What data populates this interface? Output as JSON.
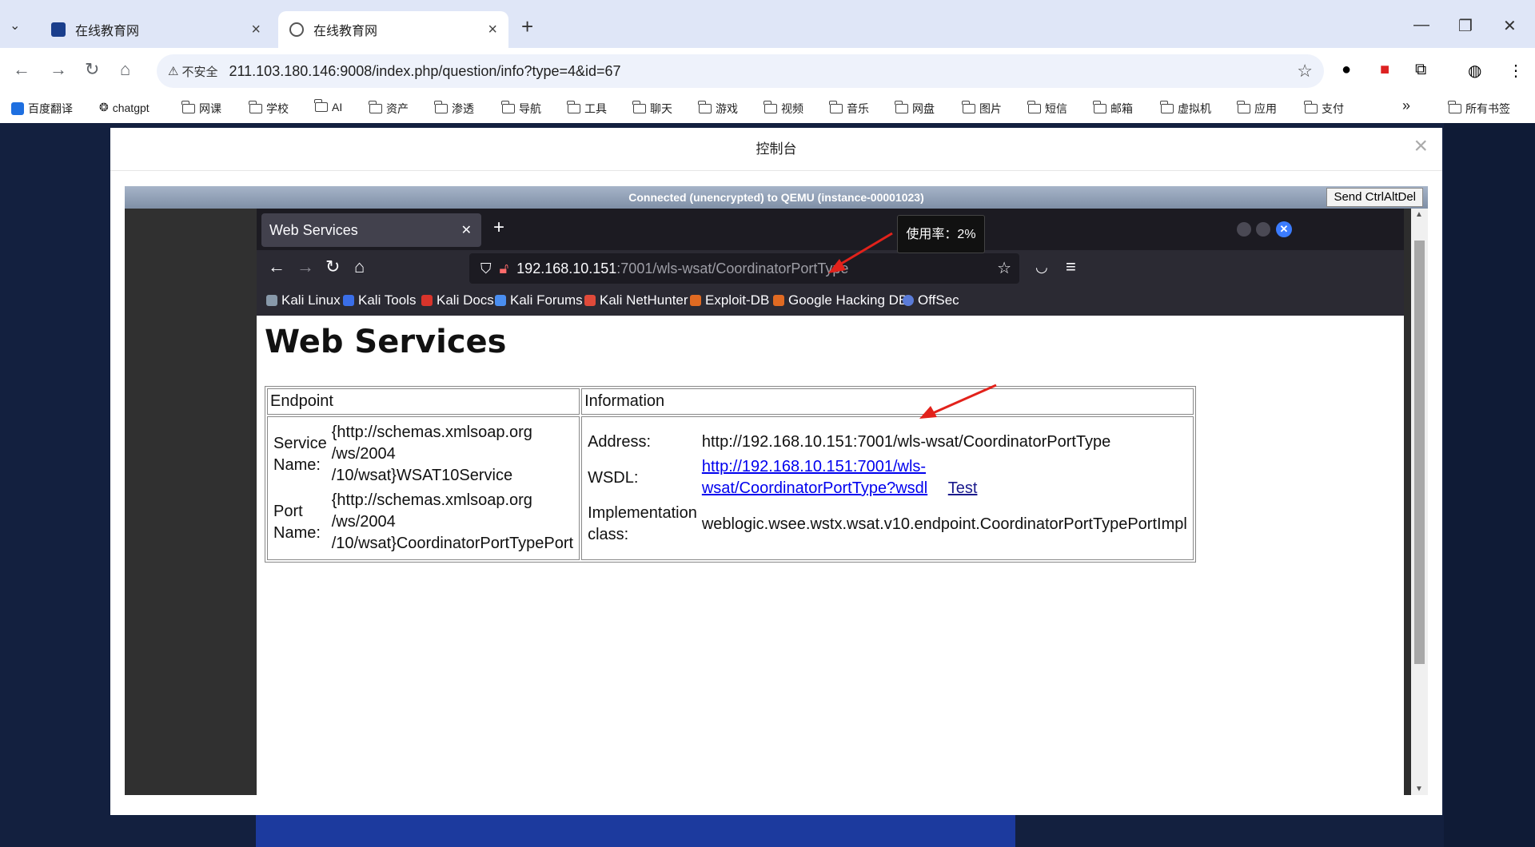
{
  "browser": {
    "tabs": [
      {
        "label": "在线教育网",
        "active": false
      },
      {
        "label": "在线教育网",
        "active": true
      }
    ],
    "url": "211.103.180.146:9008/index.php/question/info?type=4&id=67",
    "security_label": "不安全",
    "bookmarks": [
      "百度翻译",
      "chatgpt",
      "网课",
      "学校",
      "AI",
      "资产",
      "渗透",
      "导航",
      "工具",
      "聊天",
      "游戏",
      "视频",
      "音乐",
      "网盘",
      "图片",
      "短信",
      "邮箱",
      "虚拟机",
      "应用",
      "支付"
    ],
    "more_bookmarks": "»",
    "all_bookmarks": "所有书签"
  },
  "modal": {
    "title": "控制台",
    "close": "×"
  },
  "vnc": {
    "status": "Connected (unencrypted) to QEMU (instance-00001023)",
    "ctrl_alt_del": "Send CtrlAltDel"
  },
  "vm_browser": {
    "tab_title": "Web Services",
    "url_host": "192.168.10.151",
    "url_path": ":7001/wls-wsat/CoordinatorPortType",
    "tooltip": "使用率：2%",
    "bookmarks": [
      "Kali Linux",
      "Kali Tools",
      "Kali Docs",
      "Kali Forums",
      "Kali NetHunter",
      "Exploit-DB",
      "Google Hacking DB",
      "OffSec"
    ]
  },
  "page": {
    "heading": "Web Services",
    "col_endpoint": "Endpoint",
    "col_information": "Information",
    "service_name_label_1": "Service",
    "service_name_label_2": "Name:",
    "service_name_1": "{http://schemas.xmlsoap.org",
    "service_name_2": "/ws/2004",
    "service_name_3": "/10/wsat}WSAT10Service",
    "port_name_label_1": "Port",
    "port_name_label_2": "Name:",
    "port_name_1": "{http://schemas.xmlsoap.org",
    "port_name_2": "/ws/2004",
    "port_name_3": "/10/wsat}CoordinatorPortTypePort",
    "address_label": "Address:",
    "address": "http://192.168.10.151:7001/wls-wsat/CoordinatorPortType",
    "wsdl_label": "WSDL:",
    "wsdl_link_1": "http://192.168.10.151:7001/wls-",
    "wsdl_link_2": "wsat/CoordinatorPortType?wsdl",
    "test_link": "Test",
    "impl_label_1": "Implementation",
    "impl_label_2": "class:",
    "impl_class": "weblogic.wsee.wstx.wsat.v10.endpoint.CoordinatorPortTypePortImpl"
  }
}
